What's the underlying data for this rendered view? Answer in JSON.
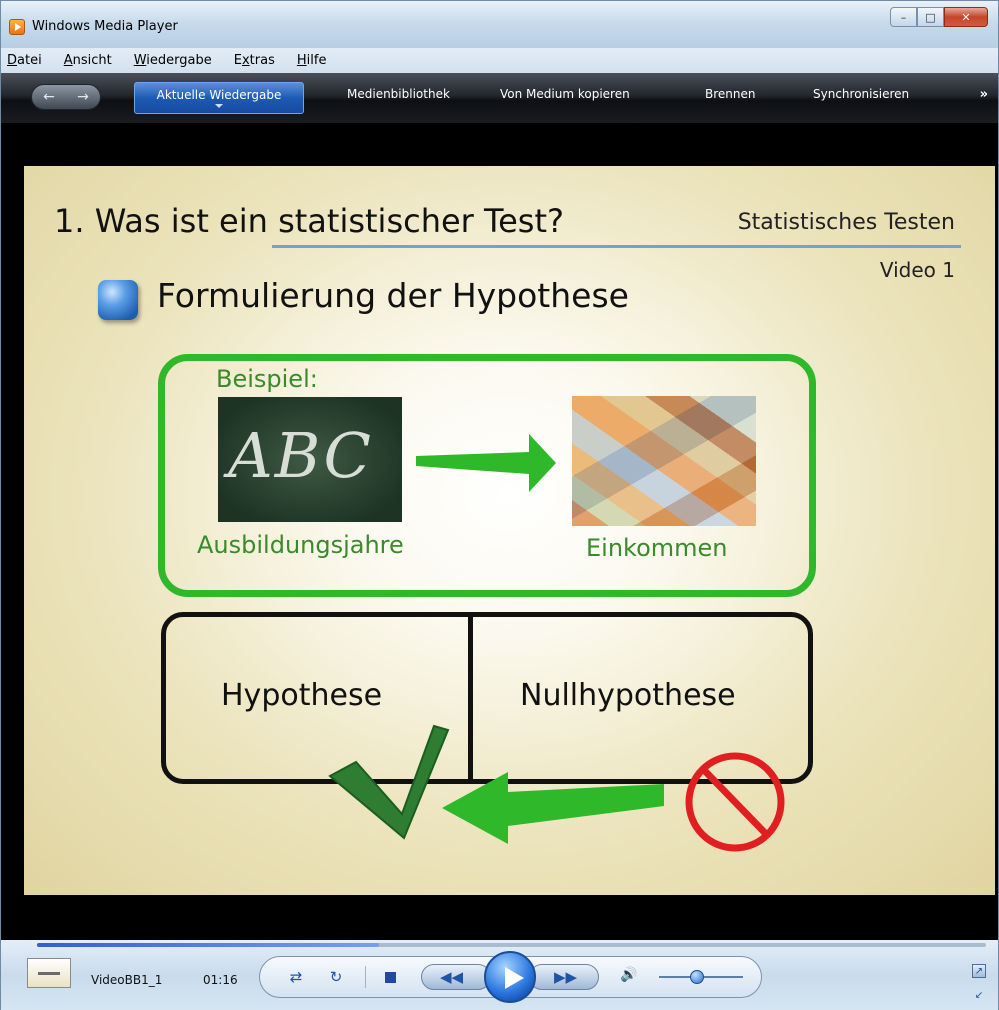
{
  "window": {
    "title": "Windows Media Player"
  },
  "menu": [
    "Datei",
    "Ansicht",
    "Wiedergabe",
    "Extras",
    "Hilfe"
  ],
  "menu_underline": [
    "D",
    "A",
    "W",
    "x",
    "H"
  ],
  "tabs": {
    "active": "Aktuelle Wiedergabe",
    "items": [
      "Medienbibliothek",
      "Von Medium kopieren",
      "Brennen",
      "Synchronisieren"
    ],
    "more": "»"
  },
  "slide": {
    "title": "1. Was ist ein statistischer Test?",
    "subject": "Statistisches Testen",
    "video_label": "Video 1",
    "heading": "Formulierung der Hypothese",
    "example_label": "Beispiel:",
    "chalk_text": "ABC",
    "left_word": "Ausbildungsjahre",
    "right_word": "Einkommen",
    "hypothesis": "Hypothese",
    "null_hypothesis": "Nullhypothese",
    "colors": {
      "green": "#2fb829",
      "check": "#2e7d32",
      "no_sign": "#e02020",
      "rule": "#6fa3d8"
    }
  },
  "player": {
    "file_name": "VideoBB1_1",
    "time": "01:16",
    "progress_fraction": 0.36,
    "volume_fraction": 0.45,
    "icons": [
      "shuffle-icon",
      "repeat-icon",
      "stop-icon",
      "previous-icon",
      "play-icon",
      "next-icon",
      "volume-icon",
      "switch-to-fullscreen-icon",
      "switch-to-compact-icon"
    ]
  }
}
